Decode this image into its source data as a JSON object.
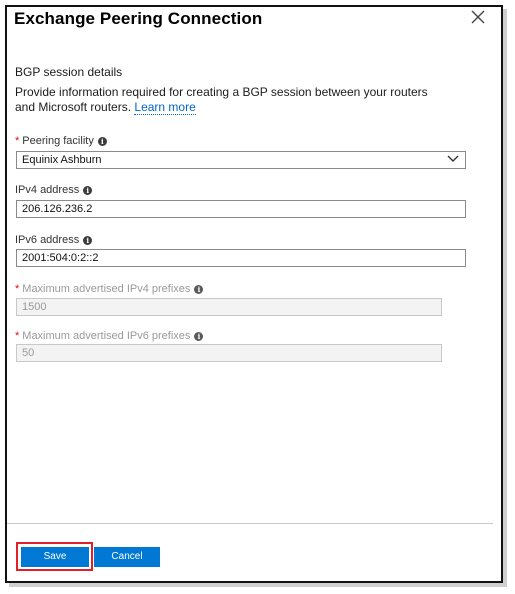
{
  "dialog": {
    "title": "Exchange Peering Connection",
    "close_icon": "close-icon"
  },
  "bgp": {
    "section_title": "BGP session details",
    "description": "Provide information required for creating a BGP session between your routers and Microsoft routers.",
    "learn_more": "Learn more"
  },
  "fields": {
    "facility": {
      "label": "Peering facility",
      "value": "Equinix Ashburn",
      "required": true
    },
    "ipv4": {
      "label": "IPv4 address",
      "value": "206.126.236.2"
    },
    "ipv6": {
      "label": "IPv6 address",
      "value": "2001:504:0:2::2"
    },
    "max_v4": {
      "label": "Maximum advertised IPv4 prefixes",
      "value": "1500",
      "required": true,
      "disabled": true
    },
    "max_v6": {
      "label": "Maximum advertised IPv6 prefixes",
      "value": "50",
      "required": true,
      "disabled": true
    }
  },
  "footer": {
    "save_label": "Save",
    "cancel_label": "Cancel"
  },
  "colors": {
    "primary": "#0078d4",
    "required": "#e00b1c",
    "highlight": "#e0202a"
  },
  "glyphs": {
    "required": "*",
    "info": "i"
  }
}
